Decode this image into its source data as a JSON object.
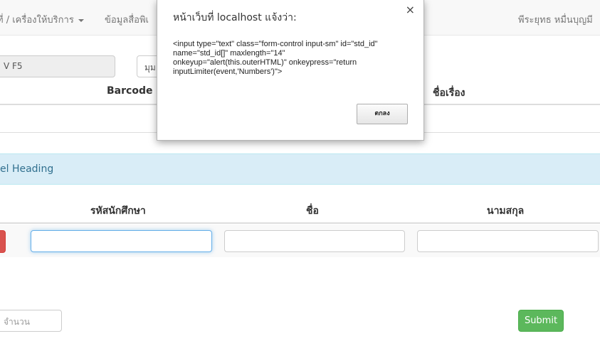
{
  "navbar": {
    "menu_service": "ที่ / เครื่องให้บริการ",
    "menu_media": "ข้อมูลสื่อพิเ",
    "user": "พีระยุทธ หมื่นบุญมี"
  },
  "form": {
    "readonly_value": "V F5",
    "second_value": "มุม"
  },
  "table1": {
    "col_barcode": "Barcode",
    "col_title": "ชื่อเรื่อง"
  },
  "panel": {
    "heading": "el Heading"
  },
  "table2": {
    "col_student_id": "รหัสนักศึกษา",
    "col_first_name": "ชื่อ",
    "col_last_name": "นามสกุล"
  },
  "footer": {
    "count_placeholder": "จำนวน",
    "submit_label": "Submit"
  },
  "dialog": {
    "title": "หน้าเว็บที่ localhost แจ้งว่า:",
    "close_glyph": "×",
    "message": "<input type=\"text\" class=\"form-control input-sm\" id=\"std_id\" name=\"std_id[]\" maxlength=\"14\" onkeyup=\"alert(this.outerHTML)\" onkeypress=\"return inputLimiter(event,'Numbers')\">",
    "ok_label": "ตกลง"
  },
  "colors": {
    "panel_bg": "#d9edf7",
    "submit_green": "#5cb85c",
    "danger_red": "#d9534f"
  }
}
